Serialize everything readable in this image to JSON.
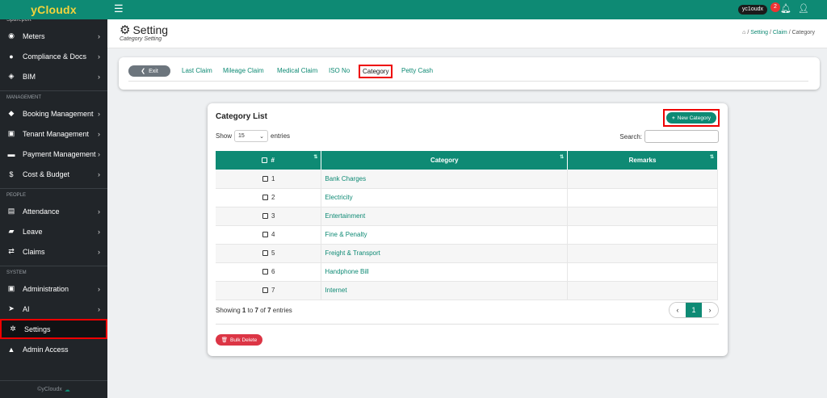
{
  "brand": "yCloudx",
  "sidebar": {
    "cut_item": "Spareport",
    "sections": [
      {
        "label": "",
        "items": [
          {
            "label": "Meters",
            "icon": "gauge-icon",
            "glyph": "◉",
            "chevron": true
          },
          {
            "label": "Compliance & Docs",
            "icon": "circle-icon",
            "glyph": "●",
            "chevron": true
          },
          {
            "label": "BIM",
            "icon": "cube-icon",
            "glyph": "◈",
            "chevron": true
          }
        ]
      },
      {
        "label": "MANAGEMENT",
        "items": [
          {
            "label": "Booking Management",
            "icon": "tag-icon",
            "glyph": "◆",
            "chevron": true
          },
          {
            "label": "Tenant Management",
            "icon": "building-icon",
            "glyph": "▣",
            "chevron": true
          },
          {
            "label": "Payment Management",
            "icon": "cart-icon",
            "glyph": "▬",
            "chevron": true
          },
          {
            "label": "Cost & Budget",
            "icon": "dollar-icon",
            "glyph": "$",
            "chevron": true
          }
        ]
      },
      {
        "label": "PEOPLE",
        "items": [
          {
            "label": "Attendance",
            "icon": "clipboard-icon",
            "glyph": "▤",
            "chevron": true
          },
          {
            "label": "Leave",
            "icon": "briefcase-icon",
            "glyph": "▰",
            "chevron": true
          },
          {
            "label": "Claims",
            "icon": "exchange-icon",
            "glyph": "⇄",
            "chevron": true
          }
        ]
      },
      {
        "label": "SYSTEM",
        "items": [
          {
            "label": "Administration",
            "icon": "id-card-icon",
            "glyph": "▣",
            "chevron": true
          },
          {
            "label": "AI",
            "icon": "paper-plane-icon",
            "glyph": "➤",
            "chevron": true
          },
          {
            "label": "Settings",
            "icon": "gear-icon",
            "glyph": "✲",
            "chevron": false,
            "active": true
          },
          {
            "label": "Admin Access",
            "icon": "lock-icon",
            "glyph": "▲",
            "chevron": false
          }
        ]
      }
    ],
    "footer": "©yCloudx"
  },
  "topbar": {
    "user": "yc1oudx",
    "notifications": "2"
  },
  "header": {
    "title": "Setting",
    "subtitle": "Category Setting",
    "breadcrumb": [
      "Setting",
      "Claim",
      "Category"
    ]
  },
  "tabs": {
    "exit": "Exit",
    "items": [
      "Last Claim",
      "Mileage Claim",
      "Medical Claim",
      "ISO No",
      "Category",
      "Petty Cash"
    ],
    "active": "Category"
  },
  "list": {
    "title": "Category List",
    "new_button": "New Category",
    "show_label": "Show",
    "entries_value": "15",
    "entries_label": "entries",
    "search_label": "Search:",
    "columns": [
      "#",
      "Category",
      "Remarks"
    ],
    "rows": [
      {
        "num": "1",
        "category": "Bank Charges",
        "remarks": ""
      },
      {
        "num": "2",
        "category": "Electricity",
        "remarks": ""
      },
      {
        "num": "3",
        "category": "Entertainment",
        "remarks": ""
      },
      {
        "num": "4",
        "category": "Fine & Penalty",
        "remarks": ""
      },
      {
        "num": "5",
        "category": "Freight & Transport",
        "remarks": ""
      },
      {
        "num": "6",
        "category": "Handphone Bill",
        "remarks": ""
      },
      {
        "num": "7",
        "category": "Internet",
        "remarks": ""
      }
    ],
    "showing": {
      "prefix": "Showing ",
      "from": "1",
      "to_word": " to ",
      "to": "7",
      "of_word": " of ",
      "total": "7",
      "suffix": " entries"
    },
    "pagination": {
      "prev": "‹",
      "current": "1",
      "next": "›"
    },
    "bulk_delete": "Bulk Delete"
  }
}
